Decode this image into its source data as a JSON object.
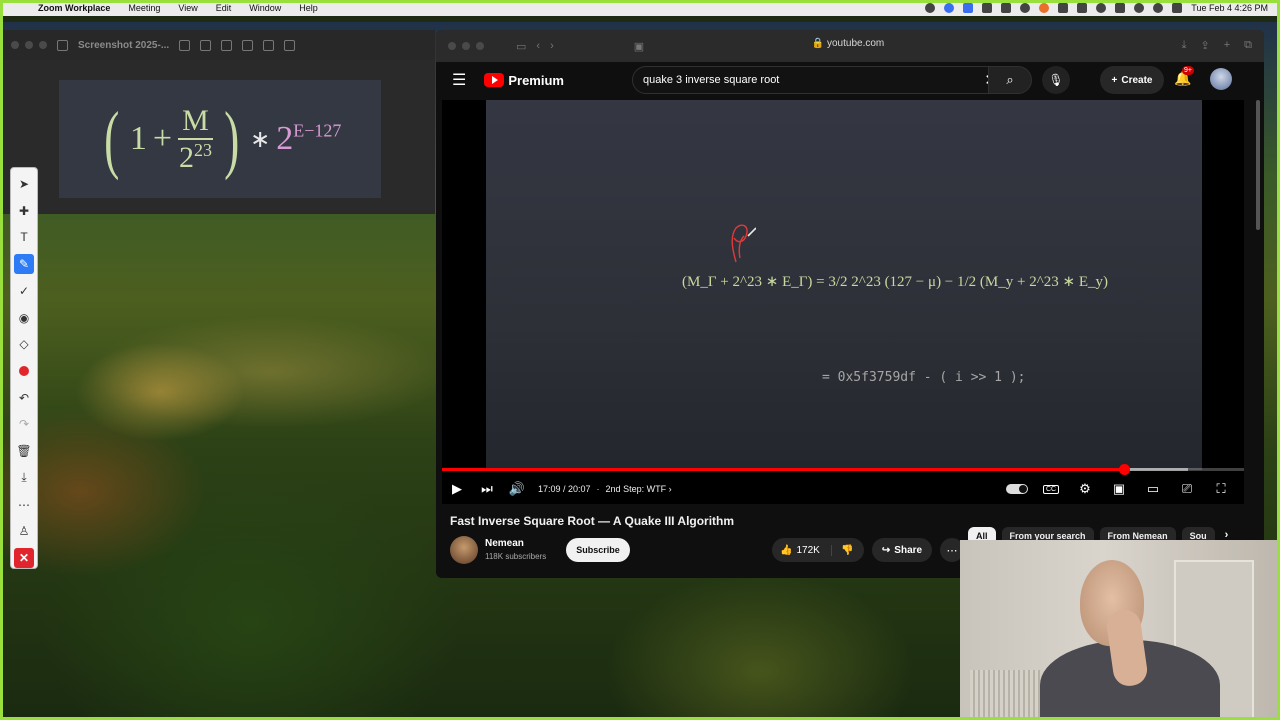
{
  "menubar": {
    "app_name": "Zoom Workplace",
    "items": [
      "Meeting",
      "View",
      "Edit",
      "Window",
      "Help"
    ],
    "clock": "Tue Feb 4  4:26 PM"
  },
  "preview": {
    "title": "Screenshot 2025-..."
  },
  "formula": {
    "one": "1",
    "plus": "+",
    "M": "M",
    "two": "2",
    "exp23": "23",
    "times": "∗",
    "exp": "E−127"
  },
  "browser": {
    "url": "youtube.com"
  },
  "youtube": {
    "brand": "Premium",
    "search_query": "quake 3 inverse square root",
    "create_label": "Create",
    "notif_badge": "9+",
    "video_title": "Fast Inverse Square Root — A Quake III Algorithm",
    "channel": "Nemean",
    "subscribers": "118K subscribers",
    "subscribe_label": "Subscribe",
    "likes": "172K",
    "share_label": "Share",
    "chips": [
      "All",
      "From your search",
      "From Nemean",
      "Sou"
    ],
    "progress_fraction": 0.85
  },
  "player": {
    "time": "17:09 / 20:07",
    "chapter": "2nd Step: WTF",
    "equation": "(M_Γ + 2^23 ∗ E_Γ) = 3/2 2^23 (127 − μ) − 1/2 (M_y + 2^23 ∗ E_y)",
    "code": "= 0x5f3759df - ( i >> 1 );"
  }
}
